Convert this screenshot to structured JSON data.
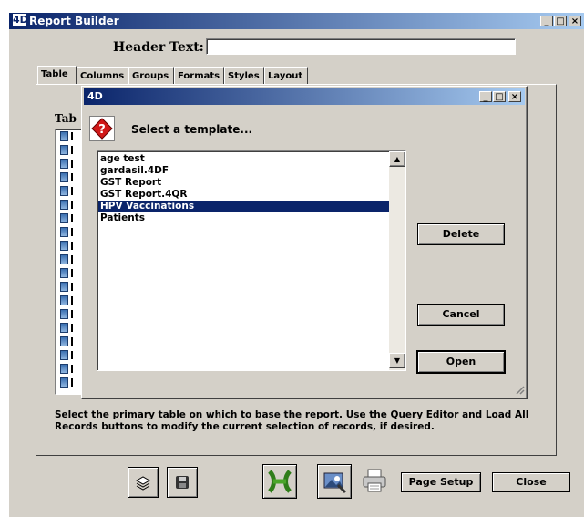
{
  "main_window": {
    "title": "Report Builder",
    "header_text_label": "Header Text:",
    "header_text_value": ""
  },
  "tabs": [
    {
      "label": "Table",
      "selected": true
    },
    {
      "label": "Columns"
    },
    {
      "label": "Groups"
    },
    {
      "label": "Formats"
    },
    {
      "label": "Styles"
    },
    {
      "label": "Layout"
    }
  ],
  "table_panel": {
    "label_fragment": "Tab",
    "help_text": "Select the primary table on which to base the report. Use the Query Editor and Load All Records buttons to modify the current selection of records, if desired."
  },
  "dialog": {
    "title_logo": "4D",
    "prompt": "Select a template...",
    "templates": [
      {
        "label": "age test"
      },
      {
        "label": "gardasil.4DF"
      },
      {
        "label": "GST Report"
      },
      {
        "label": "GST Report.4QR"
      },
      {
        "label": "HPV Vaccinations",
        "selected": true
      },
      {
        "label": "Patients"
      }
    ],
    "buttons": {
      "delete": "Delete",
      "cancel": "Cancel",
      "open": "Open"
    }
  },
  "toolbar": {
    "page_setup": "Page Setup",
    "close": "Close"
  }
}
